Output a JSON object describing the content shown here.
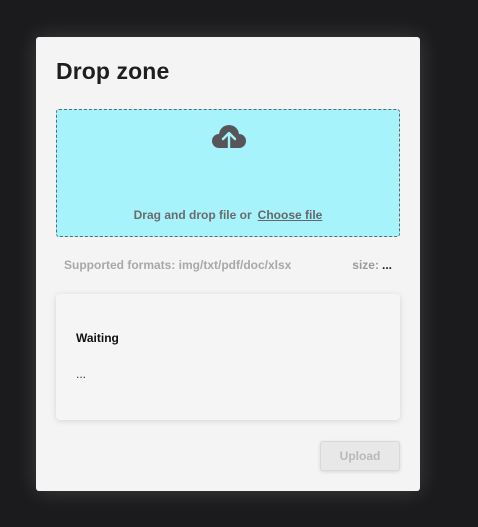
{
  "header": {
    "title": "Drop zone"
  },
  "dropzone": {
    "icon": "cloud-upload-icon",
    "prompt": "Drag and drop file or",
    "choose_label": "Choose file",
    "background_color": "#a6f3fc"
  },
  "meta": {
    "formats": "Supported formats: img/txt/pdf/doc/xlsx",
    "size_label": "size:",
    "size_value": "..."
  },
  "status": {
    "title": "Waiting",
    "detail": "..."
  },
  "actions": {
    "upload_label": "Upload"
  }
}
